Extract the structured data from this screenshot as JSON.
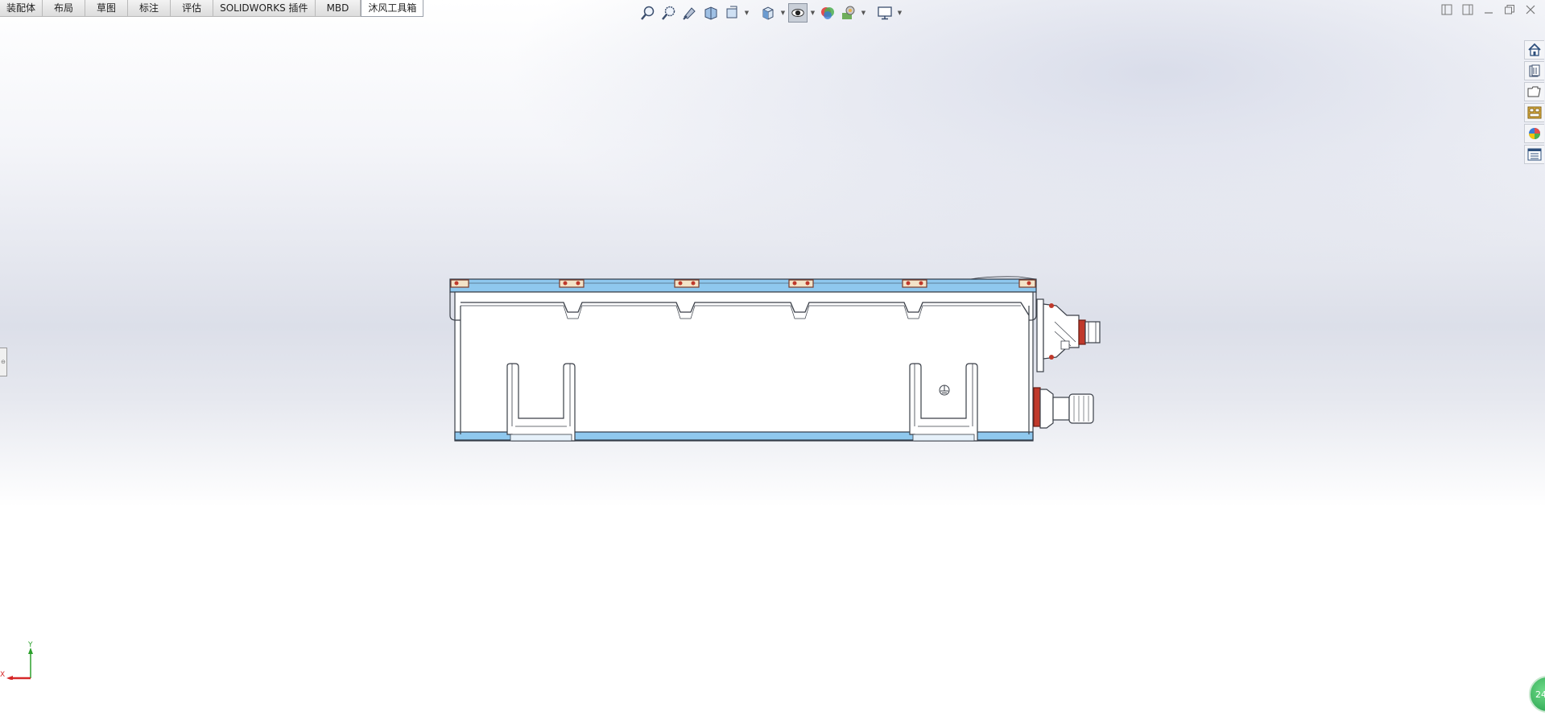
{
  "tabs": [
    {
      "label": "装配体"
    },
    {
      "label": "布局"
    },
    {
      "label": "草图"
    },
    {
      "label": "标注"
    },
    {
      "label": "评估"
    },
    {
      "label": "SOLIDWORKS 插件"
    },
    {
      "label": "MBD"
    },
    {
      "label": "沐风工具箱"
    }
  ],
  "active_tab": "沐风工具箱",
  "hud_icons": [
    "zoom-to-fit-icon",
    "zoom-to-area-icon",
    "previous-view-icon",
    "section-view-icon",
    "dynamic-annotation-icon",
    "view-orientation-icon",
    "display-style-icon",
    "hide-show-items-icon",
    "edit-appearance-icon",
    "apply-scene-icon",
    "view-settings-icon"
  ],
  "task_pane_icons": [
    "home-icon",
    "design-library-icon",
    "file-explorer-icon",
    "view-palette-icon",
    "appearances-icon",
    "custom-properties-icon"
  ],
  "triad": {
    "x_label": "X",
    "y_label": "Y"
  },
  "badge_text": "24",
  "colors": {
    "accent_blue": "#8fc8ee",
    "outline": "#3a3f48",
    "red": "#c0392b"
  }
}
